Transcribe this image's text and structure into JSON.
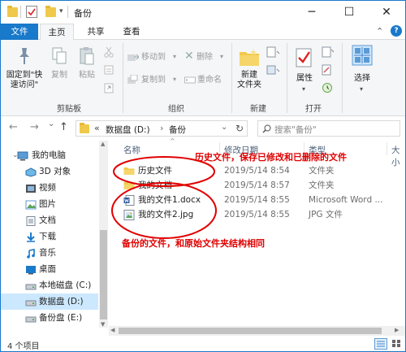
{
  "window": {
    "title": "备份",
    "minimize_glyph": "─",
    "maximize_glyph": "☐",
    "close_glyph": "✕",
    "qat_dropdown_glyph": "▾",
    "help_glyph": "?",
    "collapse_glyph": "⌃"
  },
  "tabs": [
    {
      "label": "文件"
    },
    {
      "label": "主页"
    },
    {
      "label": "共享"
    },
    {
      "label": "查看"
    }
  ],
  "ribbon": {
    "pin_label_1": "固定到\"快",
    "pin_label_2": "速访问\"",
    "copy_label": "复制",
    "paste_label": "粘贴",
    "move_to_label": "移动到",
    "copy_to_label": "复制到",
    "delete_label": "删除",
    "rename_label": "重命名",
    "new_folder_label_1": "新建",
    "new_folder_label_2": "文件夹",
    "properties_label": "属性",
    "select_label": "选择",
    "groups": [
      "剪贴板",
      "组织",
      "新建",
      "打开"
    ]
  },
  "nav": {
    "back": "←",
    "forward": "→",
    "dropdown": "⌄",
    "up": "↑",
    "breadcrumb_prefix": "«",
    "breadcrumb_drive": "数据盘 (D:)",
    "breadcrumb_sep": "›",
    "breadcrumb_folder": "备份",
    "refresh": "↻",
    "search_placeholder": "搜索\"备份\""
  },
  "sidebar": {
    "items": [
      {
        "label": "我的电脑",
        "icon": "computer-icon"
      },
      {
        "label": "3D 对象",
        "icon": "3d-objects-icon"
      },
      {
        "label": "视频",
        "icon": "video-icon"
      },
      {
        "label": "图片",
        "icon": "pictures-icon"
      },
      {
        "label": "文档",
        "icon": "documents-icon"
      },
      {
        "label": "下载",
        "icon": "download-icon"
      },
      {
        "label": "音乐",
        "icon": "music-icon"
      },
      {
        "label": "桌面",
        "icon": "desktop-icon"
      },
      {
        "label": "本地磁盘 (C:)",
        "icon": "drive-icon"
      },
      {
        "label": "数据盘 (D:)",
        "icon": "drive-icon",
        "selected": true
      },
      {
        "label": "备份盘 (E:)",
        "icon": "drive-icon"
      }
    ]
  },
  "columns": {
    "name": "名称",
    "date": "修改日期",
    "type": "类型",
    "size": "大小",
    "sort_glyph": "^"
  },
  "files": [
    {
      "name": "历史文件",
      "date": "2019/5/14 8:54",
      "type": "文件夹",
      "icon": "folder-icon"
    },
    {
      "name": "我的文档",
      "date": "2019/5/14 8:57",
      "type": "文件夹",
      "icon": "folder-icon"
    },
    {
      "name": "我的文件1.docx",
      "date": "2019/5/14 8:55",
      "type": "Microsoft Word ...",
      "icon": "word-doc-icon"
    },
    {
      "name": "我的文件2.jpg",
      "date": "2019/5/14 8:55",
      "type": "JPG 文件",
      "icon": "jpg-image-icon"
    }
  ],
  "status": {
    "count": "4 个项目"
  },
  "annotations": {
    "top": "历史文件，保存已修改和已删除的文件",
    "bottom": "备份的文件，和原始文件夹结构相同"
  },
  "colors": {
    "accent": "#1979ca",
    "selection": "#cce8ff",
    "annotation": "#e00000",
    "folder": "#f1c94a"
  }
}
